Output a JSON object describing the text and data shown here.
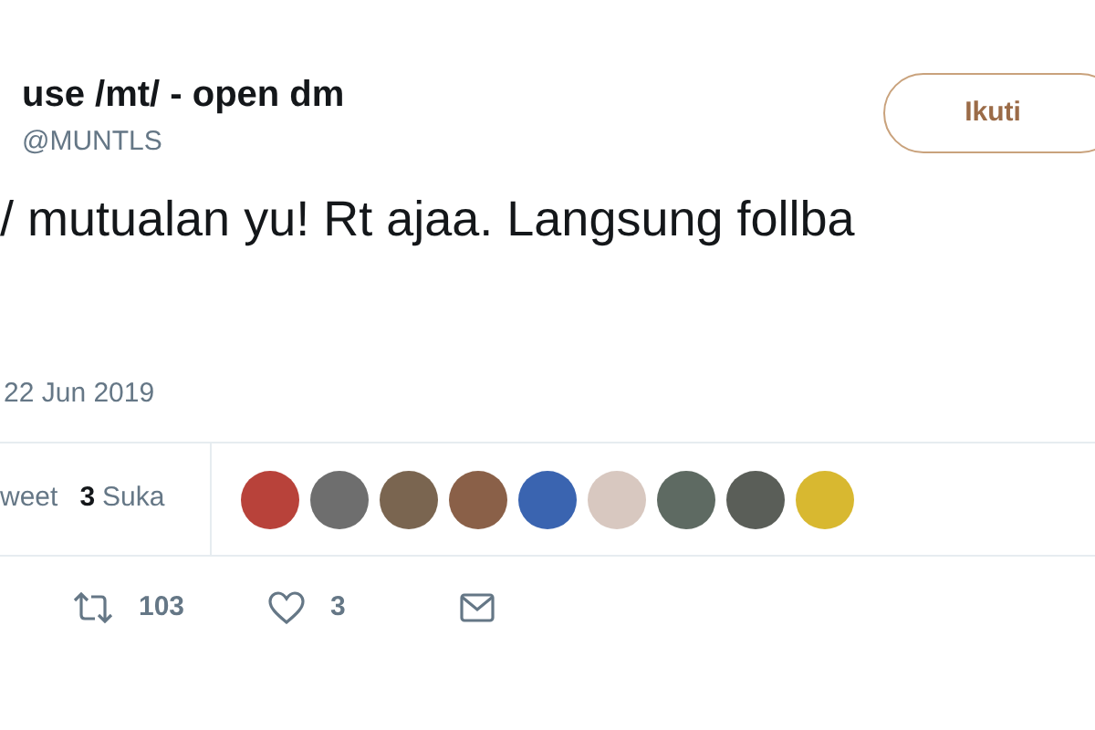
{
  "author": {
    "name": "use /mt/ - open dm",
    "handle": "@MUNTLS"
  },
  "follow_button": {
    "label": "Ikuti"
  },
  "tweet_text": "/ mutualan yu! Rt ajaa. Langsung follba",
  "date": "22 Jun 2019",
  "stats": {
    "retweets_label": "weet",
    "likes_count": "3",
    "likes_label": "Suka"
  },
  "liked_by": [
    {
      "color": "#b8423a"
    },
    {
      "color": "#6e6e6e"
    },
    {
      "color": "#7a6550"
    },
    {
      "color": "#8a6048"
    },
    {
      "color": "#3a64b0"
    },
    {
      "color": "#d8c8c0"
    },
    {
      "color": "#5e6a62"
    },
    {
      "color": "#5a5e58"
    },
    {
      "color": "#d8b830"
    }
  ],
  "actions": [
    {
      "kind": "retweet",
      "count": "103"
    },
    {
      "kind": "like",
      "count": "3"
    },
    {
      "kind": "message"
    }
  ]
}
